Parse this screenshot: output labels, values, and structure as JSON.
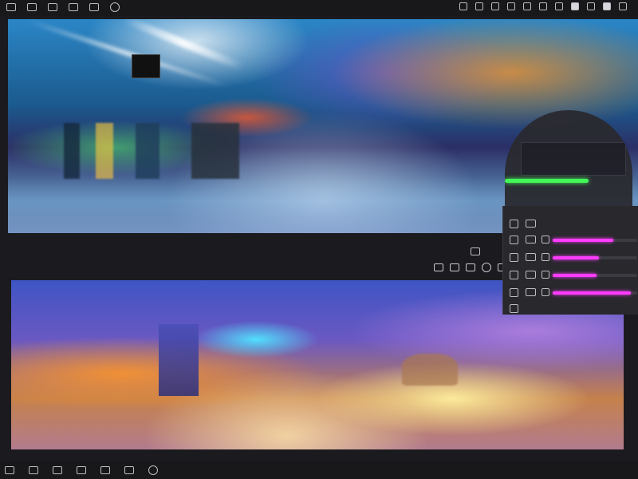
{
  "toolbar": {
    "left_icons": [
      "layers-icon",
      "camera-icon",
      "image-icon",
      "stack-icon",
      "photo-icon",
      "settings-icon"
    ],
    "right_icons": [
      "crop-icon",
      "link-icon",
      "grid-icon",
      "frame-icon",
      "pin-icon",
      "share-icon",
      "brush-icon",
      "flag-icon",
      "wand-icon",
      "fill-icon",
      "bucket-icon"
    ]
  },
  "views": {
    "top": "render-preview-top",
    "bottom": "render-preview-bottom"
  },
  "mid_controls": {
    "icons": [
      "preview-icon",
      "note-icon",
      "camera-icon",
      "circle-icon",
      "grid-icon"
    ]
  },
  "lens_overlay": {
    "green_level": 0.66
  },
  "adjust_panel": {
    "rows": [
      {
        "icon": "rotate-icon",
        "level": null
      },
      {
        "icon": "edit-icon",
        "level": 0.72
      },
      {
        "icon": "shape-icon",
        "level": 0.55
      },
      {
        "icon": "shield-icon",
        "level": 0.52
      },
      {
        "icon": "camera-icon",
        "level": 0.92
      },
      {
        "icon": "minus-icon",
        "level": null
      }
    ],
    "accent": "#ff3cff"
  },
  "statusbar": {
    "icons": [
      "grid-icon",
      "window-icon",
      "stack-icon",
      "frame-icon",
      "panel-icon",
      "layer-icon",
      "settings-icon"
    ]
  }
}
